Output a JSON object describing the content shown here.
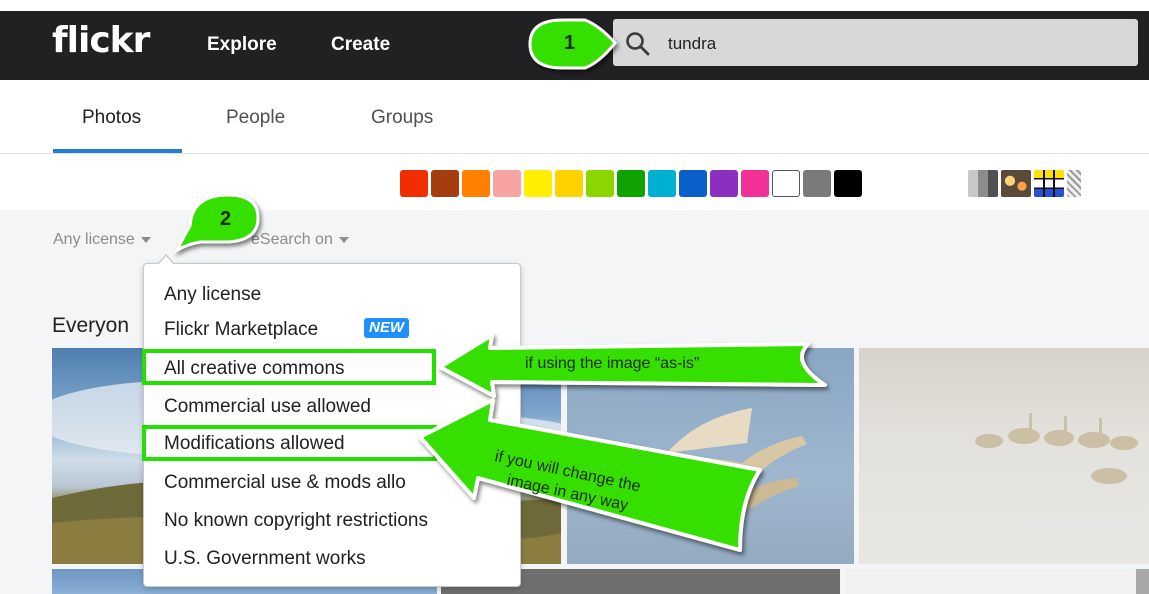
{
  "header": {
    "logo": "flickr",
    "nav": [
      "Explore",
      "Create"
    ],
    "search_value": "tundra"
  },
  "tabs": [
    {
      "label": "Photos",
      "active": true
    },
    {
      "label": "People",
      "active": false
    },
    {
      "label": "Groups",
      "active": false
    }
  ],
  "color_swatches": [
    "#f22e00",
    "#a53d0e",
    "#ff7f00",
    "#f7a3a3",
    "#ffee00",
    "#ffd200",
    "#8dd500",
    "#10a300",
    "#00b0cf",
    "#0a5fc9",
    "#8a2fbf",
    "#f23098",
    "#ffffff",
    "#7a7a7a",
    "#000000"
  ],
  "filters": {
    "license": "Any license",
    "safesearch": "SafeSearch on",
    "safesearch_visible": "eSearch on"
  },
  "section_title": "Everyon",
  "license_menu": {
    "options": [
      "Any license",
      "Flickr Marketplace",
      "All creative commons",
      "Commercial use allowed",
      "Modifications allowed",
      "Commercial use & mods allo",
      "No known copyright restrictions",
      "U.S. Government works"
    ],
    "new_badge": "NEW"
  },
  "annotations": {
    "step1": "1",
    "step2": "2",
    "callout_as_is": "if using the image “as-is”",
    "callout_change": [
      "if you will change the",
      "image in any way"
    ],
    "accent": "#22e000"
  }
}
